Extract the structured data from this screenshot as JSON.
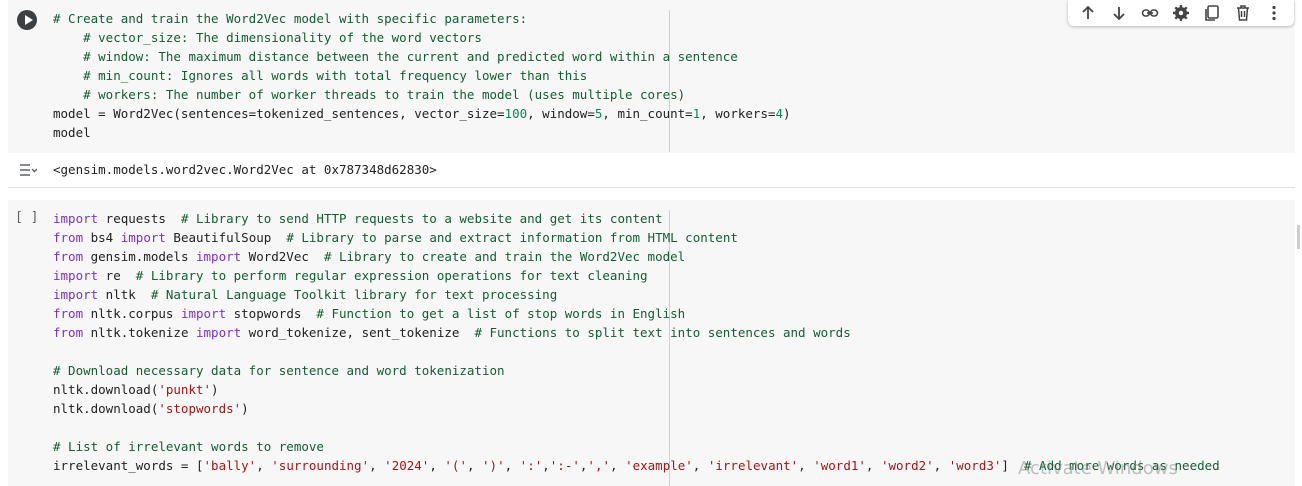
{
  "cell1": {
    "lines": [
      [
        {
          "t": "# Create and train the Word2Vec model with specific parameters:",
          "c": "cm"
        }
      ],
      [
        {
          "t": "    # vector_size: The dimensionality of the word vectors",
          "c": "cm"
        }
      ],
      [
        {
          "t": "    # window: The maximum distance between the current and predicted word within a sentence",
          "c": "cm"
        }
      ],
      [
        {
          "t": "    # min_count: Ignores all words with total frequency lower than this",
          "c": "cm"
        }
      ],
      [
        {
          "t": "    # workers: The number of worker threads to train the model (uses multiple cores)",
          "c": "cm"
        }
      ],
      [
        {
          "t": "model = Word2Vec(sentences=tokenized_sentences, vector_size=",
          "c": ""
        },
        {
          "t": "100",
          "c": "nm"
        },
        {
          "t": ", window=",
          "c": ""
        },
        {
          "t": "5",
          "c": "nm"
        },
        {
          "t": ", min_count=",
          "c": ""
        },
        {
          "t": "1",
          "c": "nm"
        },
        {
          "t": ", workers=",
          "c": ""
        },
        {
          "t": "4",
          "c": "nm"
        },
        {
          "t": ")",
          "c": ""
        }
      ],
      [
        {
          "t": "model",
          "c": ""
        }
      ]
    ]
  },
  "output": {
    "text": "<gensim.models.word2vec.Word2Vec at 0x787348d62830>"
  },
  "cell2": {
    "bracket": "[ ]",
    "lines": [
      [
        {
          "t": "import",
          "c": "kw"
        },
        {
          "t": " requests  ",
          "c": ""
        },
        {
          "t": "# Library to send HTTP requests to a website and get its content",
          "c": "cm"
        }
      ],
      [
        {
          "t": "from",
          "c": "kw"
        },
        {
          "t": " bs4 ",
          "c": ""
        },
        {
          "t": "import",
          "c": "kw"
        },
        {
          "t": " BeautifulSoup  ",
          "c": ""
        },
        {
          "t": "# Library to parse and extract information from HTML content",
          "c": "cm"
        }
      ],
      [
        {
          "t": "from",
          "c": "kw"
        },
        {
          "t": " gensim.models ",
          "c": ""
        },
        {
          "t": "import",
          "c": "kw"
        },
        {
          "t": " Word2Vec  ",
          "c": ""
        },
        {
          "t": "# Library to create and train the Word2Vec model",
          "c": "cm"
        }
      ],
      [
        {
          "t": "import",
          "c": "kw"
        },
        {
          "t": " re  ",
          "c": ""
        },
        {
          "t": "# Library to perform regular expression operations for text cleaning",
          "c": "cm"
        }
      ],
      [
        {
          "t": "import",
          "c": "kw"
        },
        {
          "t": " nltk  ",
          "c": ""
        },
        {
          "t": "# Natural Language Toolkit library for text processing",
          "c": "cm"
        }
      ],
      [
        {
          "t": "from",
          "c": "kw"
        },
        {
          "t": " nltk.corpus ",
          "c": ""
        },
        {
          "t": "import",
          "c": "kw"
        },
        {
          "t": " stopwords  ",
          "c": ""
        },
        {
          "t": "# Function to get a list of stop words in English",
          "c": "cm"
        }
      ],
      [
        {
          "t": "from",
          "c": "kw"
        },
        {
          "t": " nltk.tokenize ",
          "c": ""
        },
        {
          "t": "import",
          "c": "kw"
        },
        {
          "t": " word_tokenize, sent_tokenize  ",
          "c": ""
        },
        {
          "t": "# Functions to split text into sentences and words",
          "c": "cm"
        }
      ],
      [
        {
          "t": "",
          "c": ""
        }
      ],
      [
        {
          "t": "# Download necessary data for sentence and word tokenization",
          "c": "cm"
        }
      ],
      [
        {
          "t": "nltk.download(",
          "c": ""
        },
        {
          "t": "'punkt'",
          "c": "st"
        },
        {
          "t": ")",
          "c": ""
        }
      ],
      [
        {
          "t": "nltk.download(",
          "c": ""
        },
        {
          "t": "'stopwords'",
          "c": "st"
        },
        {
          "t": ")",
          "c": ""
        }
      ],
      [
        {
          "t": "",
          "c": ""
        }
      ],
      [
        {
          "t": "# List of irrelevant words to remove",
          "c": "cm"
        }
      ],
      [
        {
          "t": "irrelevant_words = [",
          "c": ""
        },
        {
          "t": "'bally'",
          "c": "st"
        },
        {
          "t": ", ",
          "c": ""
        },
        {
          "t": "'surrounding'",
          "c": "st"
        },
        {
          "t": ", ",
          "c": ""
        },
        {
          "t": "'2024'",
          "c": "st"
        },
        {
          "t": ", ",
          "c": ""
        },
        {
          "t": "'('",
          "c": "st"
        },
        {
          "t": ", ",
          "c": ""
        },
        {
          "t": "')'",
          "c": "st"
        },
        {
          "t": ", ",
          "c": ""
        },
        {
          "t": "':'",
          "c": "st"
        },
        {
          "t": ",",
          "c": ""
        },
        {
          "t": "':-'",
          "c": "st"
        },
        {
          "t": ",",
          "c": ""
        },
        {
          "t": "','",
          "c": "st"
        },
        {
          "t": ", ",
          "c": ""
        },
        {
          "t": "'example'",
          "c": "st"
        },
        {
          "t": ", ",
          "c": ""
        },
        {
          "t": "'irrelevant'",
          "c": "st"
        },
        {
          "t": ", ",
          "c": ""
        },
        {
          "t": "'word1'",
          "c": "st"
        },
        {
          "t": ", ",
          "c": ""
        },
        {
          "t": "'word2'",
          "c": "st"
        },
        {
          "t": ", ",
          "c": ""
        },
        {
          "t": "'word3'",
          "c": "st"
        },
        {
          "t": "]  ",
          "c": ""
        },
        {
          "t": "# Add more words as needed",
          "c": "cm"
        }
      ]
    ]
  },
  "toolbar": {
    "items": [
      "move-up-icon",
      "move-down-icon",
      "link-icon",
      "settings-icon",
      "mirror-cell-icon",
      "delete-icon",
      "more-vert-icon"
    ]
  },
  "watermark": "Activate Windows"
}
